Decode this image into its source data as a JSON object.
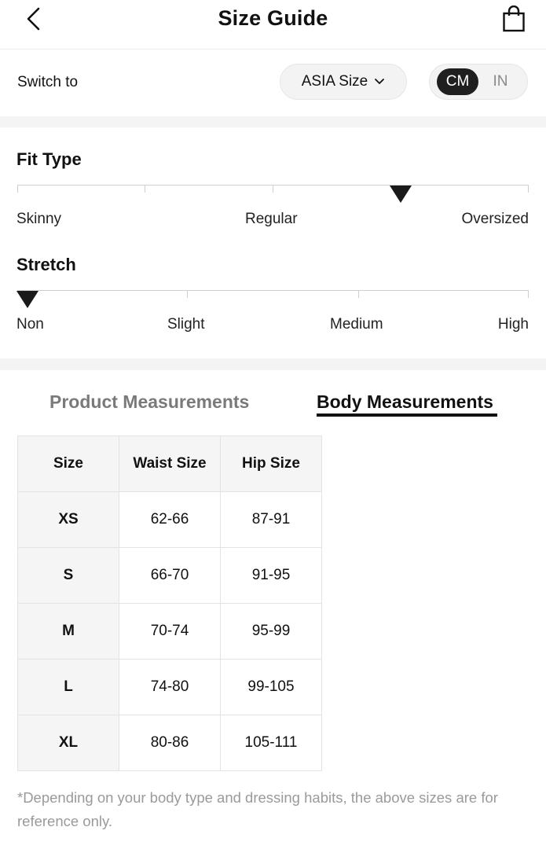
{
  "header": {
    "title": "Size Guide",
    "back_icon": "chevron-left-icon",
    "bag_icon": "shopping-bag-icon"
  },
  "switch": {
    "label": "Switch to",
    "region_value": "ASIA Size",
    "units": [
      "CM",
      "IN"
    ],
    "active_unit": "CM"
  },
  "fit_type": {
    "title": "Fit Type",
    "labels": [
      "Skinny",
      "Regular",
      "Oversized"
    ],
    "selected_position": 0.75
  },
  "stretch": {
    "title": "Stretch",
    "labels": [
      "Non",
      "Slight",
      "Medium",
      "High"
    ],
    "selected": "Non"
  },
  "tabs": {
    "product": "Product Measurements",
    "body": "Body Measurements",
    "active": "Body Measurements"
  },
  "table": {
    "headers": [
      "Size",
      "Waist Size",
      "Hip Size"
    ],
    "rows": [
      [
        "XS",
        "62-66",
        "87-91"
      ],
      [
        "S",
        "66-70",
        "91-95"
      ],
      [
        "M",
        "70-74",
        "95-99"
      ],
      [
        "L",
        "74-80",
        "99-105"
      ],
      [
        "XL",
        "80-86",
        "105-111"
      ]
    ]
  },
  "footnote": "*Depending on your body type and dressing habits, the above sizes are for reference only.",
  "colors": {
    "accent": "#1f1f1f",
    "muted_text": "#9a9a9a",
    "divider": "#f4f4f4"
  }
}
